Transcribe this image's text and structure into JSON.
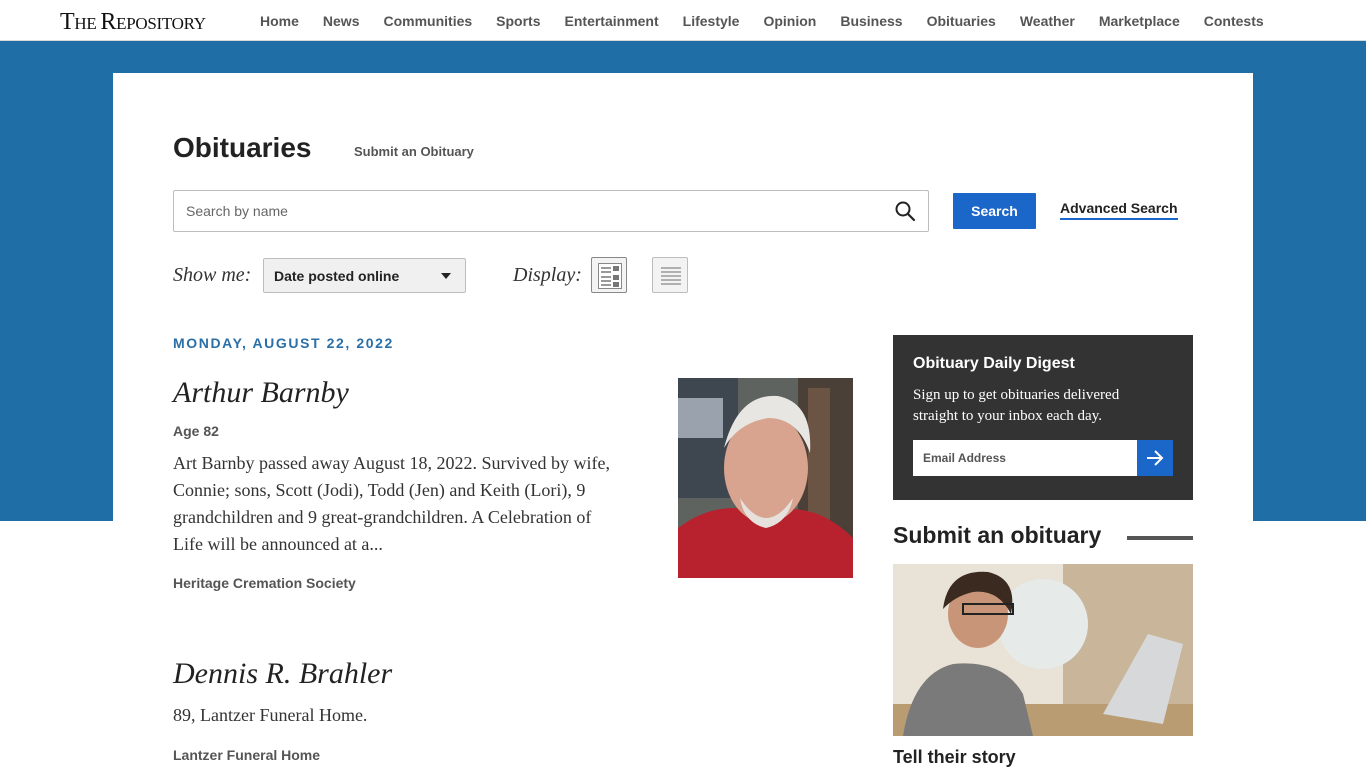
{
  "site": {
    "logo_big_t": "T",
    "logo_he": "HE ",
    "logo_big_r": "R",
    "logo_rest": "EPOSITORY"
  },
  "nav": {
    "items": [
      "Home",
      "News",
      "Communities",
      "Sports",
      "Entertainment",
      "Lifestyle",
      "Opinion",
      "Business",
      "Obituaries",
      "Weather",
      "Marketplace",
      "Contests"
    ]
  },
  "page": {
    "title": "Obituaries",
    "submit_link": "Submit an Obituary"
  },
  "search": {
    "placeholder": "Search by name",
    "button_label": "Search",
    "advanced_label": "Advanced Search"
  },
  "filters": {
    "show_me_label": "Show me:",
    "sort_selected": "Date posted online",
    "display_label": "Display:"
  },
  "listing": {
    "date_heading": "MONDAY, AUGUST 22, 2022",
    "obits": [
      {
        "name": "Arthur Barnby",
        "age": "Age 82",
        "text": "Art Barnby passed away August 18, 2022. Survived by wife, Connie; sons, Scott (Jodi), Todd (Jen) and Keith (Lori), 9 grandchildren and 9 great-grandchildren. A Celebration of Life will be announced at a...",
        "funeral_home": "Heritage Cremation Society"
      },
      {
        "name": "Dennis R. Brahler",
        "text": "89, Lantzer Funeral Home.",
        "funeral_home": "Lantzer Funeral Home"
      }
    ]
  },
  "sidebar": {
    "digest_title": "Obituary Daily Digest",
    "digest_text": "Sign up to get obituaries delivered straight to your inbox each day.",
    "email_placeholder": "Email Address",
    "submit_title": "Submit an obituary",
    "submit_caption": "Tell their story"
  },
  "colors": {
    "band_blue": "#1f6fa6",
    "button_blue": "#1a66c9",
    "date_blue": "#2a6fa8",
    "digest_bg": "#333333"
  }
}
